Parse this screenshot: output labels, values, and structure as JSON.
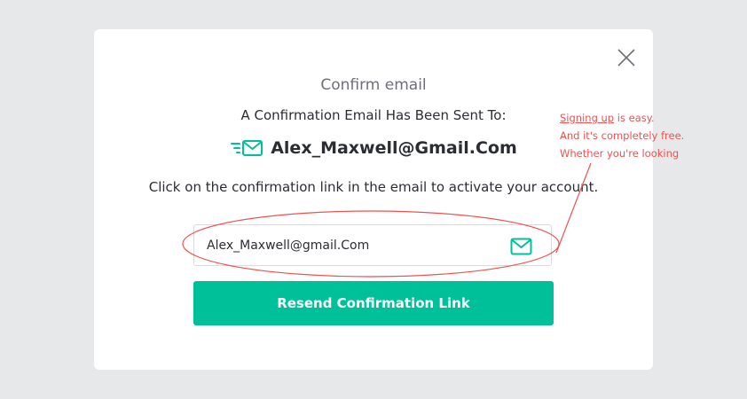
{
  "modal": {
    "title": "Confirm email",
    "sent_to_label": "A Confirmation Email Has Been Sent To:",
    "email": "Alex_Maxwell@Gmail.Com",
    "instruction": "Click on the confirmation link in the email to activate your account.",
    "close_icon": "close-icon"
  },
  "email_field": {
    "value": "Alex_Maxwell@gmail.Com",
    "icon": "envelope-icon"
  },
  "resend_button": {
    "label": "Resend Confirmation Link"
  },
  "annotation": {
    "link_text": "Signing up",
    "line1_rest": " is easy.",
    "line2": "And it's completely free.",
    "line3": "Whether you're looking"
  },
  "colors": {
    "accent": "#00c09a",
    "annotation": "#f0504f",
    "background": "#e7e8ea",
    "text": "#2b2d33"
  }
}
